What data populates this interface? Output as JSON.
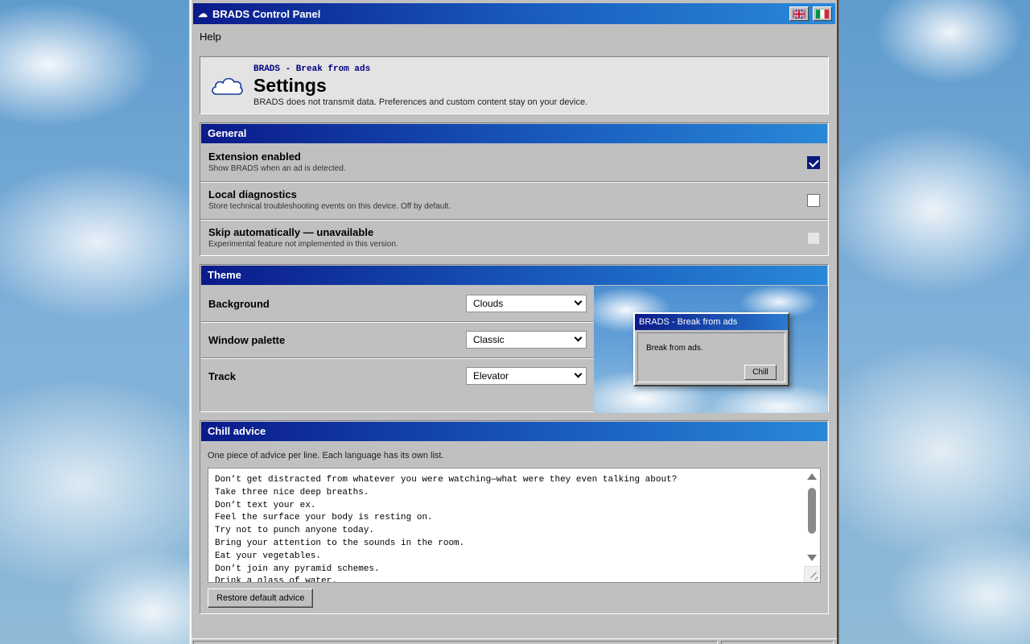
{
  "window": {
    "title": "BRADS Control Panel",
    "title_icon": "cloud-icon",
    "flags": [
      "uk-flag-icon",
      "italy-flag-icon"
    ]
  },
  "menu": {
    "help": "Help"
  },
  "header": {
    "brand": "BRADS - Break from ads",
    "title": "Settings",
    "subtitle": "BRADS does not transmit data. Preferences and custom content stay on your device."
  },
  "general": {
    "title": "General",
    "rows": [
      {
        "label": "Extension enabled",
        "desc": "Show BRADS when an ad is detected.",
        "checked": true,
        "disabled": false
      },
      {
        "label": "Local diagnostics",
        "desc": "Store technical troubleshooting events on this device. Off by default.",
        "checked": false,
        "disabled": false
      },
      {
        "label": "Skip automatically — unavailable",
        "desc": "Experimental feature not implemented in this version.",
        "checked": false,
        "disabled": true
      }
    ]
  },
  "theme": {
    "title": "Theme",
    "rows": [
      {
        "label": "Background",
        "value": "Clouds"
      },
      {
        "label": "Window palette",
        "value": "Classic"
      },
      {
        "label": "Track",
        "value": "Elevator"
      }
    ],
    "preview": {
      "title": "BRADS - Break from ads",
      "message": "Break from ads.",
      "button": "Chill"
    }
  },
  "advice": {
    "title": "Chill advice",
    "help": "One piece of advice per line. Each language has its own list.",
    "lines": [
      "Don’t get distracted from whatever you were watching—what were they even talking about?",
      "Take three nice deep breaths.",
      "Don’t text your ex.",
      "Feel the surface your body is resting on.",
      "Try not to punch anyone today.",
      "Bring your attention to the sounds in the room.",
      "Eat your vegetables.",
      "Don’t join any pyramid schemes.",
      "Drink a glass of water."
    ],
    "restore": "Restore default advice"
  }
}
